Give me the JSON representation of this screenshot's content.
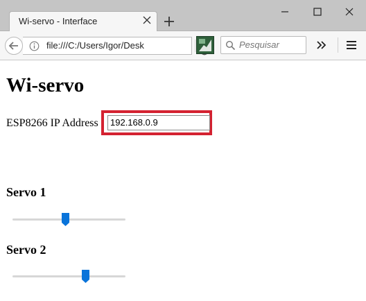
{
  "browser": {
    "tab_title": "Wi-servo - Interface",
    "url": "file:///C:/Users/Igor/Desk",
    "search_placeholder": "Pesquisar"
  },
  "page": {
    "heading": "Wi-servo",
    "ip_label": "ESP8266 IP Address",
    "ip_value": "192.168.0.9",
    "highlight_color": "#d42231",
    "servos": [
      {
        "label": "Servo 1",
        "value_fraction": 0.47
      },
      {
        "label": "Servo 2",
        "value_fraction": 0.66
      }
    ],
    "slider_color": "#0a74da"
  }
}
